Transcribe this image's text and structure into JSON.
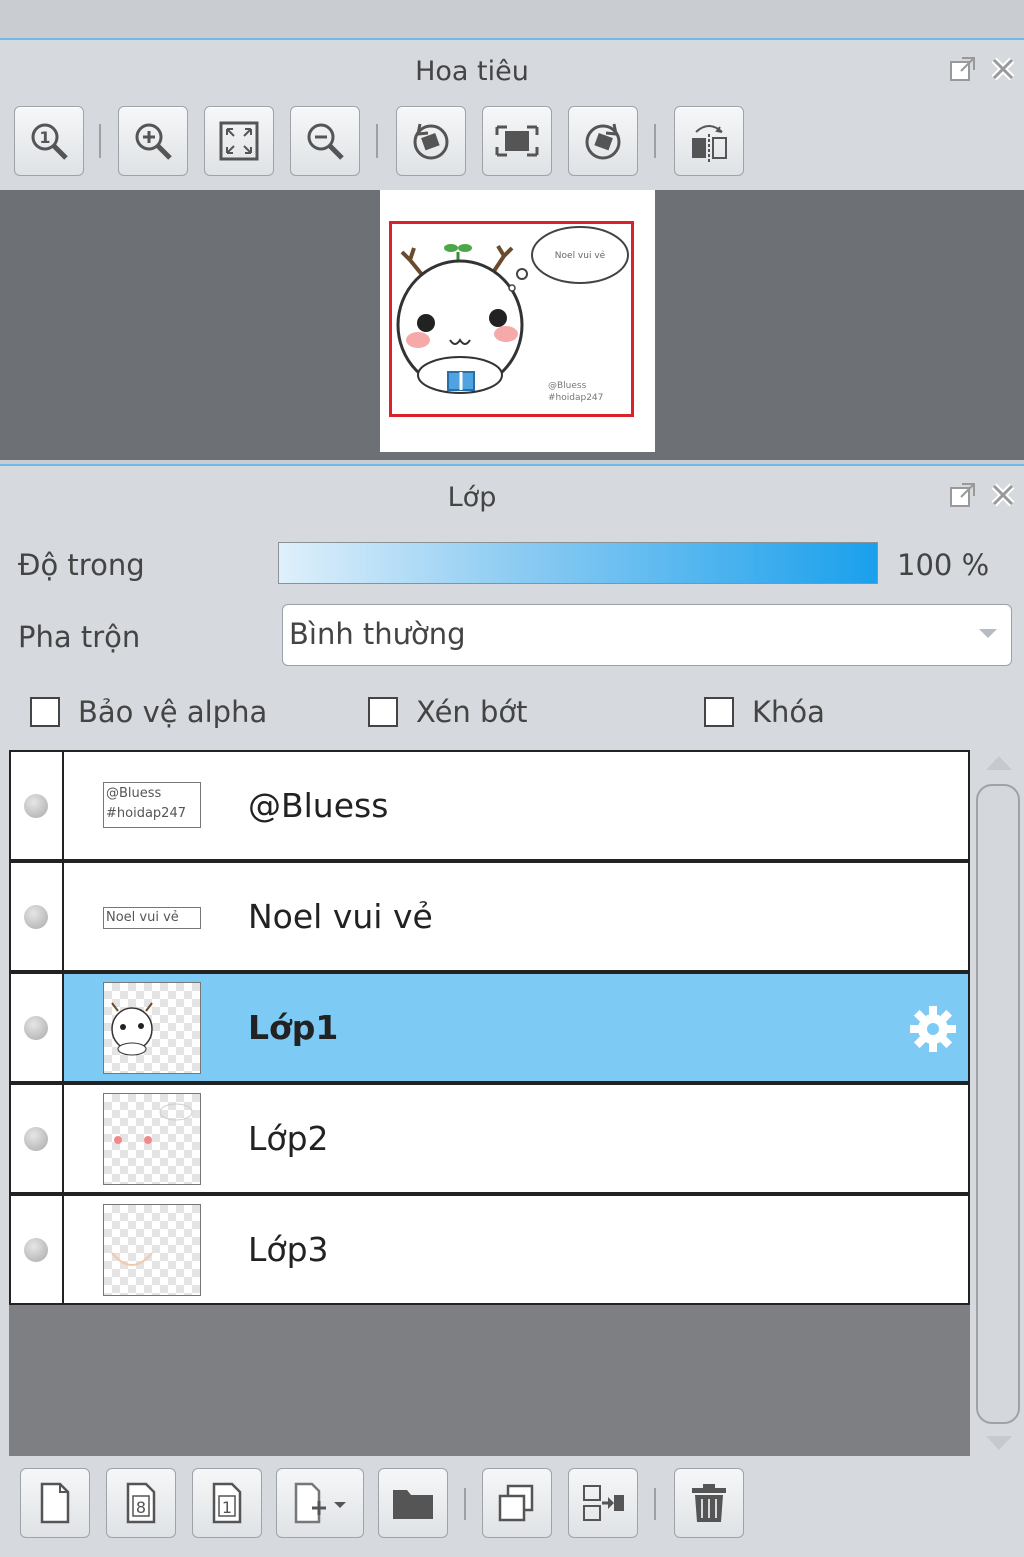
{
  "navigator": {
    "title": "Hoa tiêu",
    "preview": {
      "bubble_text": "Noel vui vẻ",
      "credit_line1": "@Bluess",
      "credit_line2": "#hoidap247"
    }
  },
  "layers": {
    "title": "Lớp",
    "opacity_label": "Độ trong",
    "opacity_value_text": "100 %",
    "opacity_value": 100,
    "blend_label": "Pha trộn",
    "blend_value": "Bình thường",
    "checkboxes": {
      "protect_alpha": "Bảo vệ alpha",
      "clipping": "Xén bớt",
      "lock": "Khóa"
    },
    "items": [
      {
        "name": "@Bluess",
        "thumb_line1": "@Bluess",
        "thumb_line2": "#hoidap247"
      },
      {
        "name": "Noel vui vẻ",
        "thumb_line1": "Noel vui vẻ"
      },
      {
        "name": "Lớp1",
        "selected": true
      },
      {
        "name": "Lớp2"
      },
      {
        "name": "Lớp3"
      }
    ]
  },
  "colors": {
    "selection": "#7dcbf4",
    "panel_accent": "#6fb8e8",
    "frame_red": "#d9232c"
  }
}
